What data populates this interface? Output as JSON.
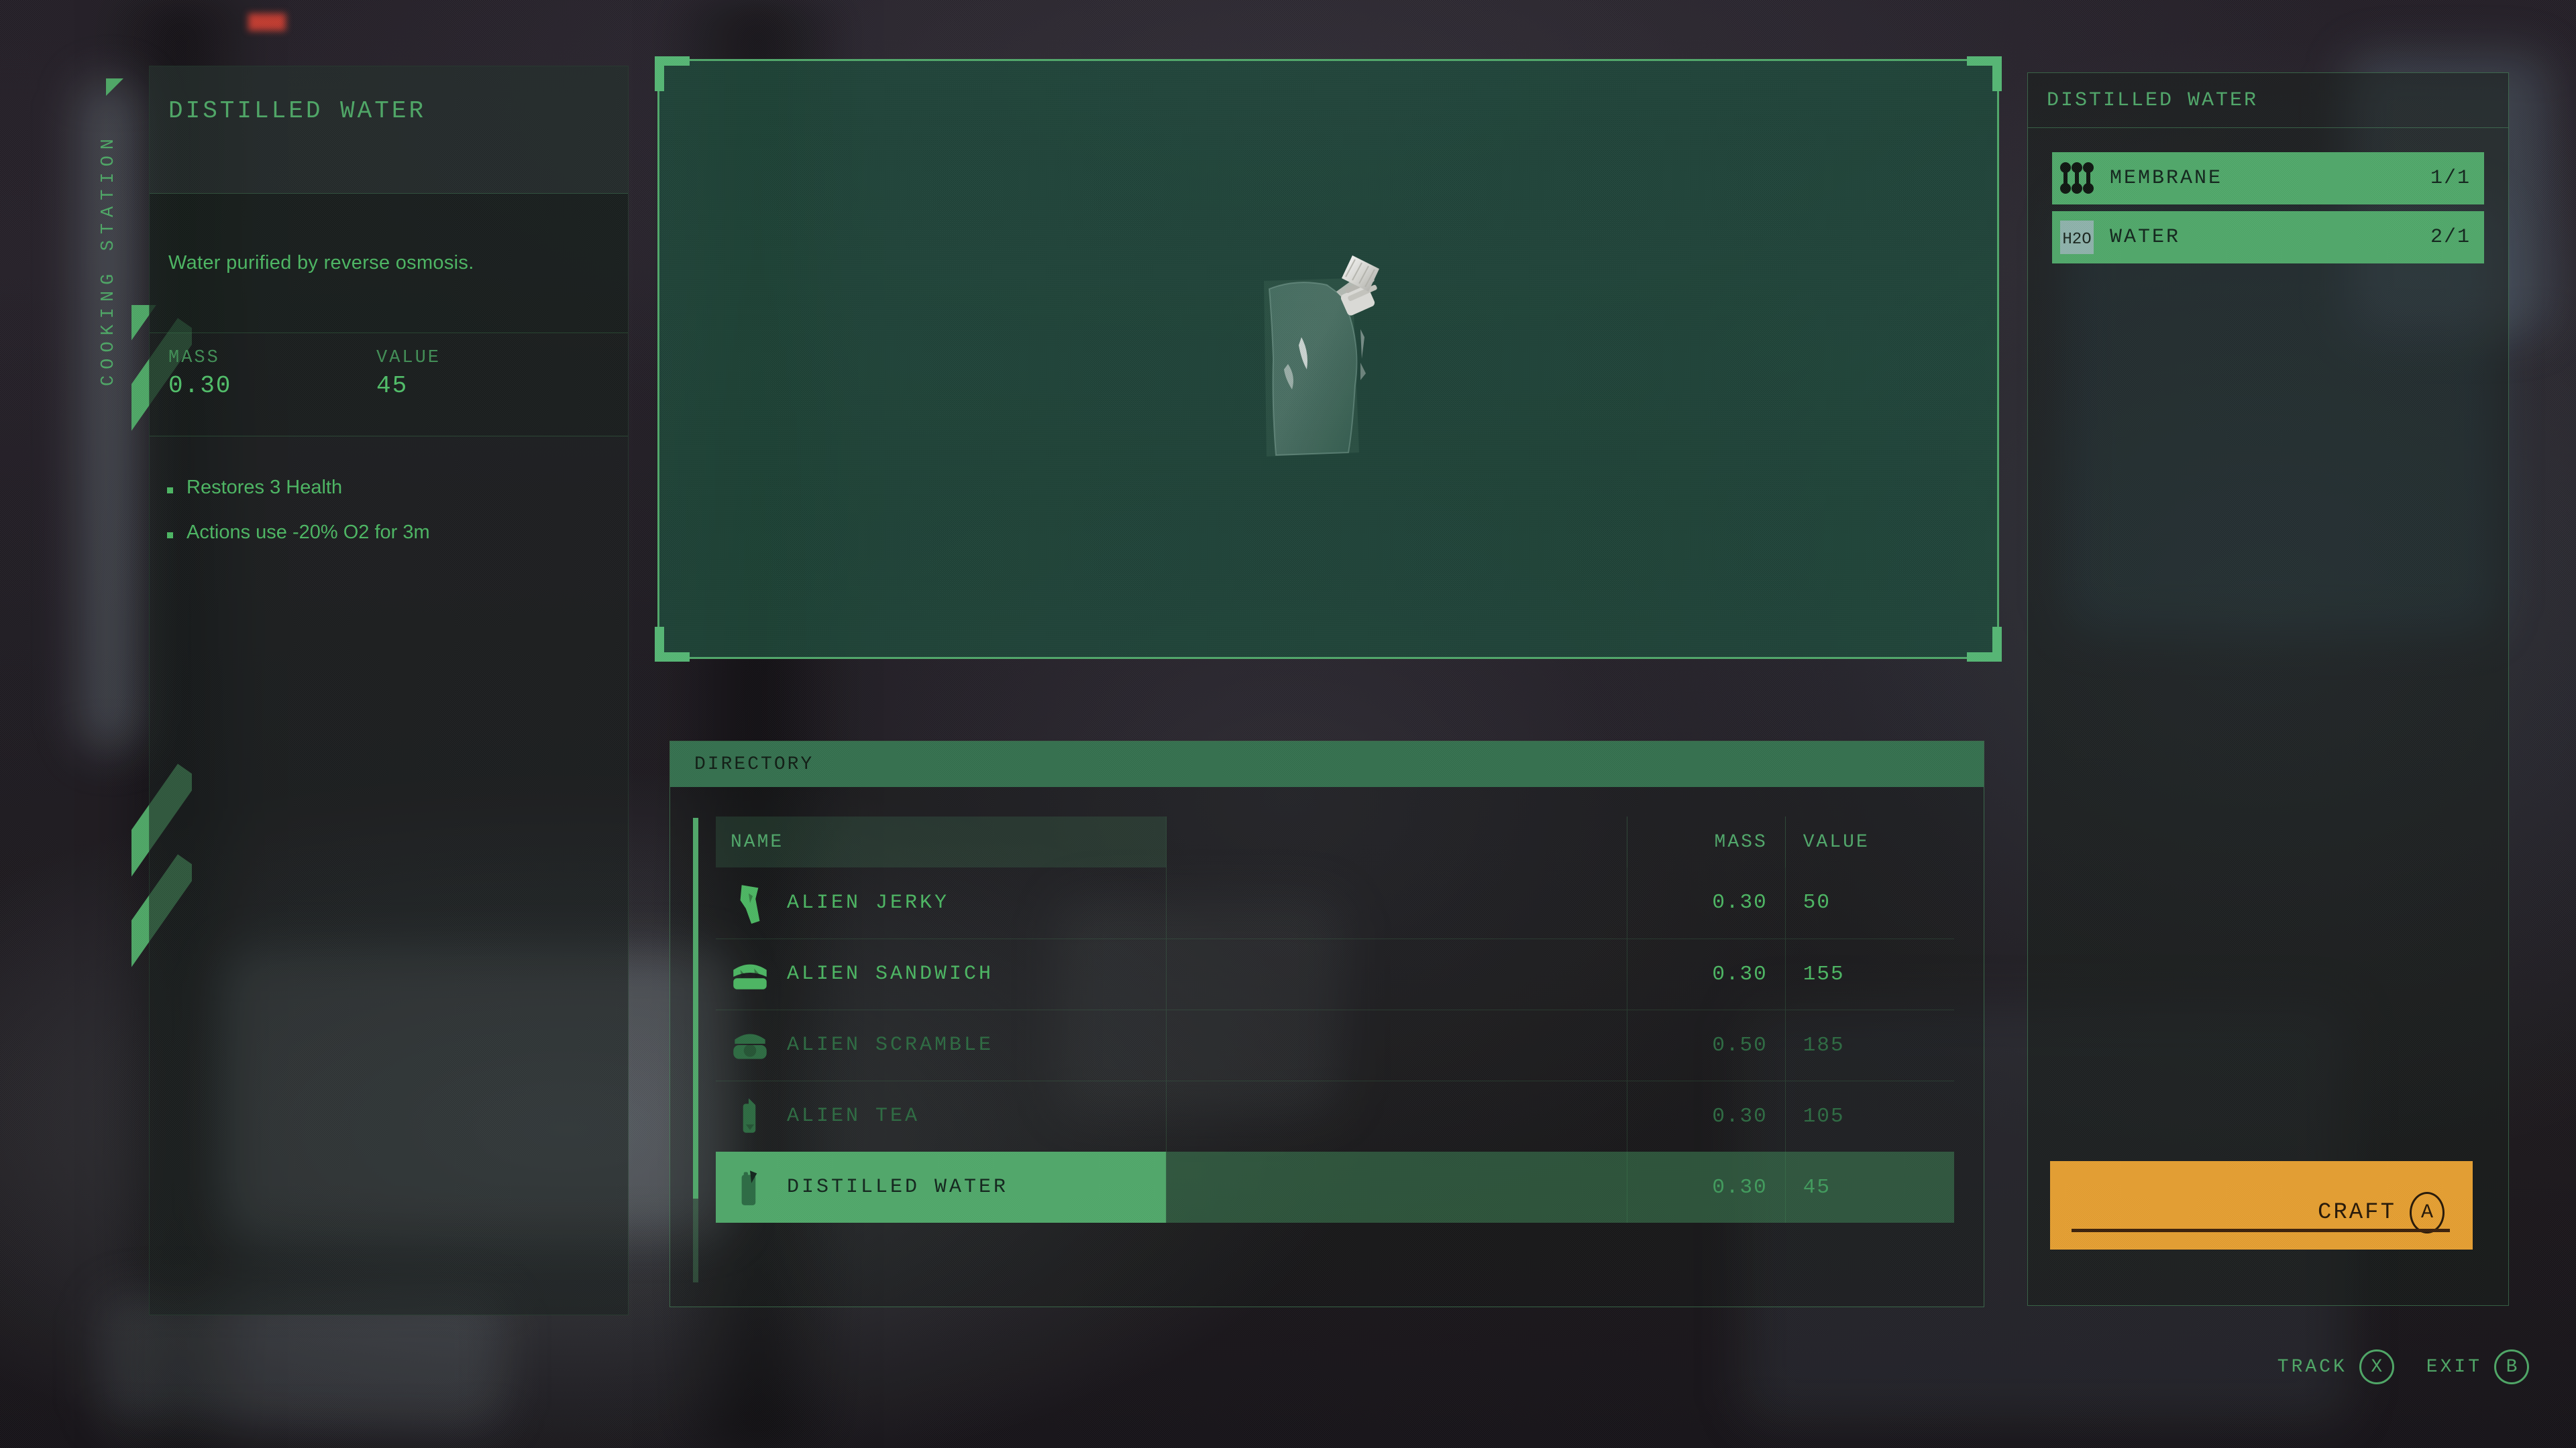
{
  "station": {
    "label": "COOKING STATION"
  },
  "item_info": {
    "title": "DISTILLED WATER",
    "description": "Water purified by reverse osmosis.",
    "mass_label": "MASS",
    "mass_value": "0.30",
    "value_label": "VALUE",
    "value_value": "45",
    "effects": [
      "Restores 3 Health",
      "Actions use -20% O2 for 3m"
    ]
  },
  "preview": {
    "item_icon": "water-pouch"
  },
  "directory": {
    "header": "DIRECTORY",
    "columns": {
      "name": "NAME",
      "mass": "MASS",
      "value": "VALUE"
    },
    "rows": [
      {
        "icon": "alien-jerky-icon",
        "name": "ALIEN JERKY",
        "mass": "0.30",
        "value": "50",
        "state": "available"
      },
      {
        "icon": "alien-sandwich-icon",
        "name": "ALIEN SANDWICH",
        "mass": "0.30",
        "value": "155",
        "state": "available"
      },
      {
        "icon": "alien-scramble-icon",
        "name": "ALIEN SCRAMBLE",
        "mass": "0.50",
        "value": "185",
        "state": "unavailable"
      },
      {
        "icon": "alien-tea-icon",
        "name": "ALIEN TEA",
        "mass": "0.30",
        "value": "105",
        "state": "unavailable"
      },
      {
        "icon": "distilled-water-icon",
        "name": "DISTILLED WATER",
        "mass": "0.30",
        "value": "45",
        "state": "selected"
      }
    ]
  },
  "recipe": {
    "title": "DISTILLED WATER",
    "ingredients": [
      {
        "icon": "membrane-icon",
        "name": "MEMBRANE",
        "qty": "1/1"
      },
      {
        "icon": "h2o-icon",
        "name": "WATER",
        "qty": "2/1"
      }
    ]
  },
  "craft_button": {
    "label": "CRAFT",
    "button_glyph": "A"
  },
  "prompts": [
    {
      "label": "TRACK",
      "glyph": "X"
    },
    {
      "label": "EXIT",
      "glyph": "B"
    }
  ],
  "colors": {
    "accent_green": "#4da866",
    "bright_green": "#4fa96a",
    "dim_green": "#2b6b41",
    "craft_orange": "#e8a030",
    "panel_dark": "#1a1f1c"
  }
}
